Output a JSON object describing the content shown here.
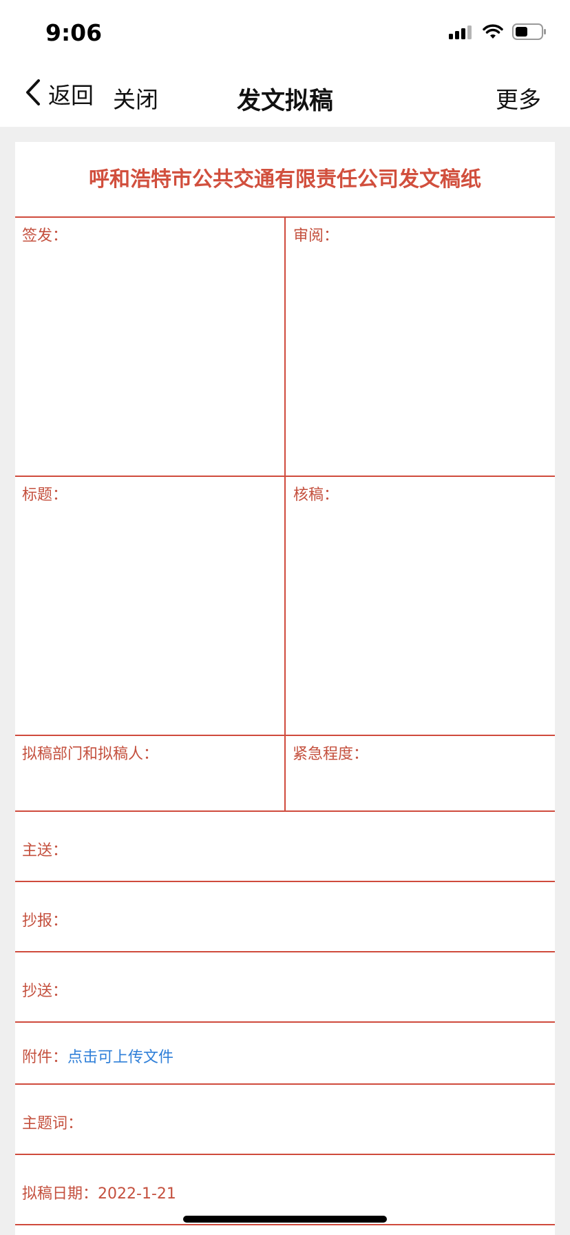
{
  "status_bar": {
    "time": "9:06"
  },
  "nav": {
    "back_label": "返回",
    "close_label": "关闭",
    "title": "发文拟稿",
    "more_label": "更多"
  },
  "form": {
    "title": "呼和浩特市公共交通有限责任公司发文稿纸",
    "sign_label": "签发：",
    "review_label": "审阅：",
    "subject_label": "标题：",
    "check_label": "核稿：",
    "drafter_label": "拟稿部门和拟稿人：",
    "urgency_label": "紧急程度：",
    "main_send_label": "主送：",
    "report_to_label": "抄报：",
    "copy_to_label": "抄送：",
    "attachment_label": "附件：",
    "attachment_link": "点击可上传文件",
    "keywords_label": "主题词：",
    "draft_date_label": "拟稿日期：",
    "draft_date_value": "2022-1-21"
  },
  "colors": {
    "form_red": "#cf4a3c",
    "link_blue": "#2f7fd8"
  }
}
